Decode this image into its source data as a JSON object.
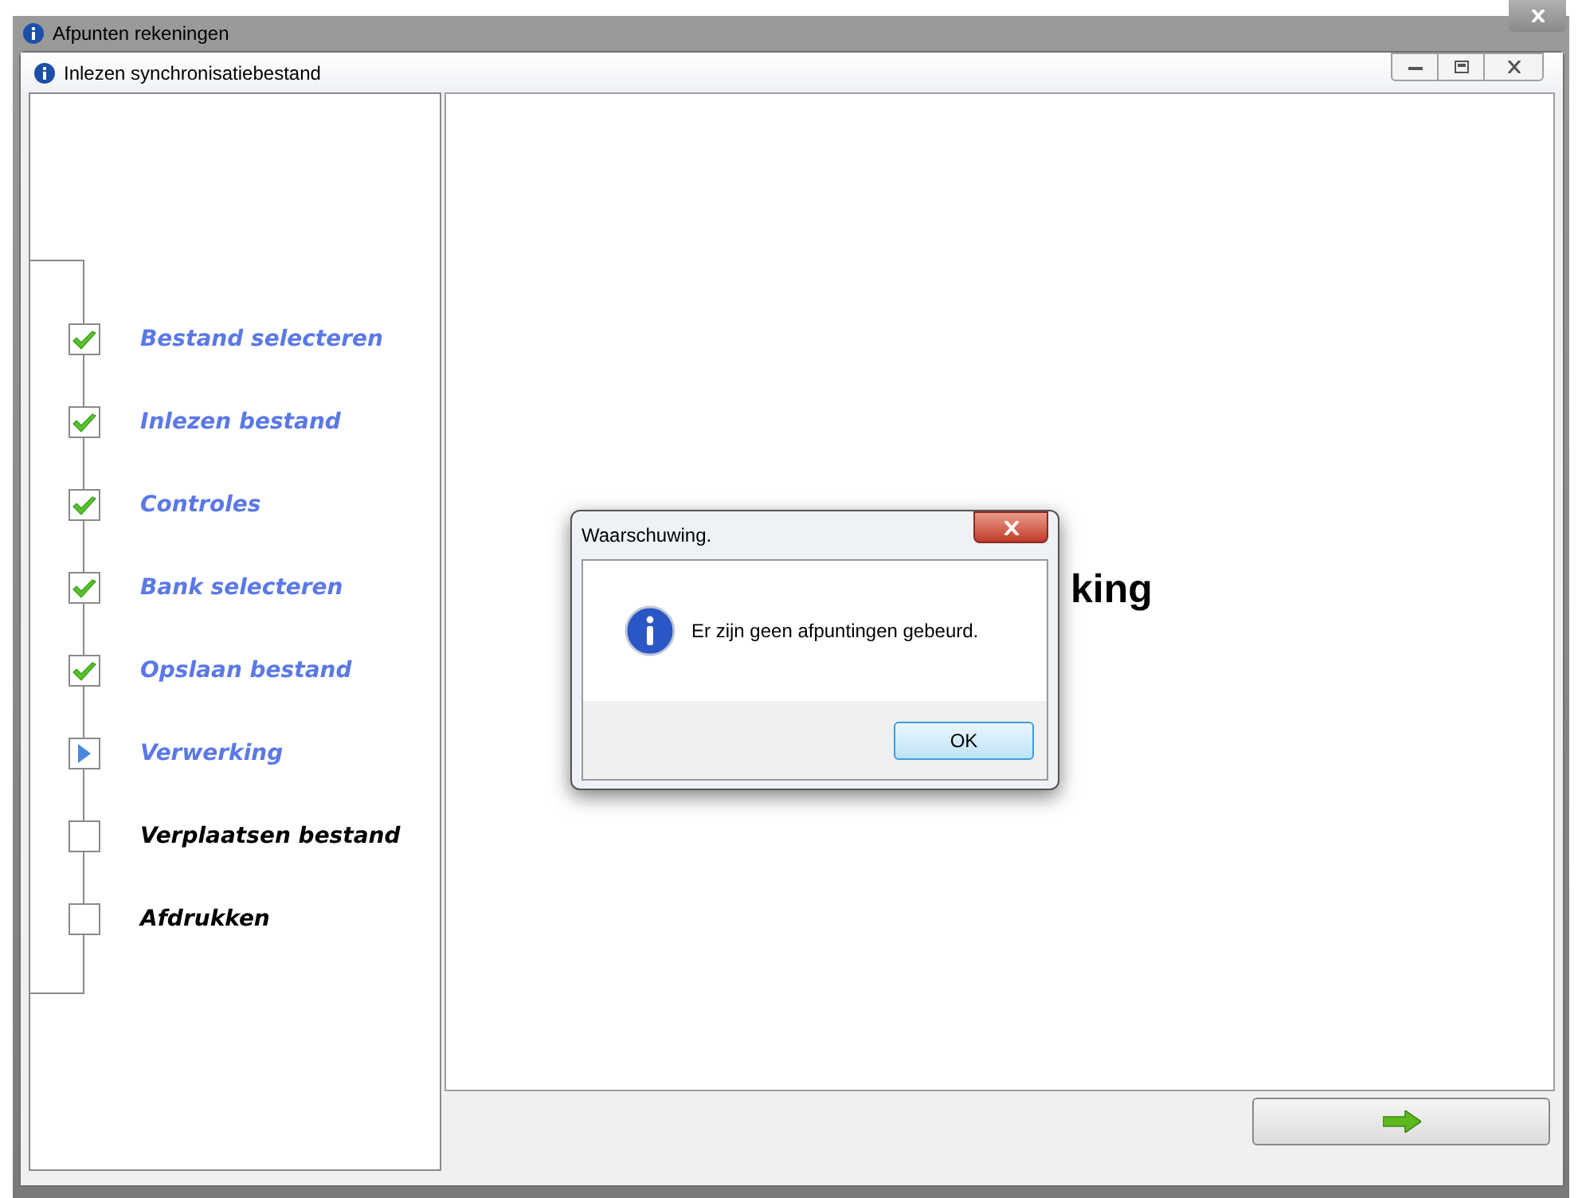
{
  "outer_window": {
    "title": "Afpunten rekeningen"
  },
  "window": {
    "title": "Inlezen synchronisatiebestand"
  },
  "steps": [
    {
      "label": "Bestand selecteren",
      "kind": "done"
    },
    {
      "label": "Inlezen bestand",
      "kind": "done"
    },
    {
      "label": "Controles",
      "kind": "done"
    },
    {
      "label": "Bank selecteren",
      "kind": "done"
    },
    {
      "label": "Opslaan bestand",
      "kind": "done"
    },
    {
      "label": "Verwerking",
      "kind": "current"
    },
    {
      "label": "Verplaatsen bestand",
      "kind": "pending"
    },
    {
      "label": "Afdrukken",
      "kind": "pending"
    }
  ],
  "content": {
    "heading": "king"
  },
  "dialog": {
    "title": "Waarschuwing.",
    "message": "Er zijn geen afpuntingen gebeurd.",
    "button": "OK"
  }
}
